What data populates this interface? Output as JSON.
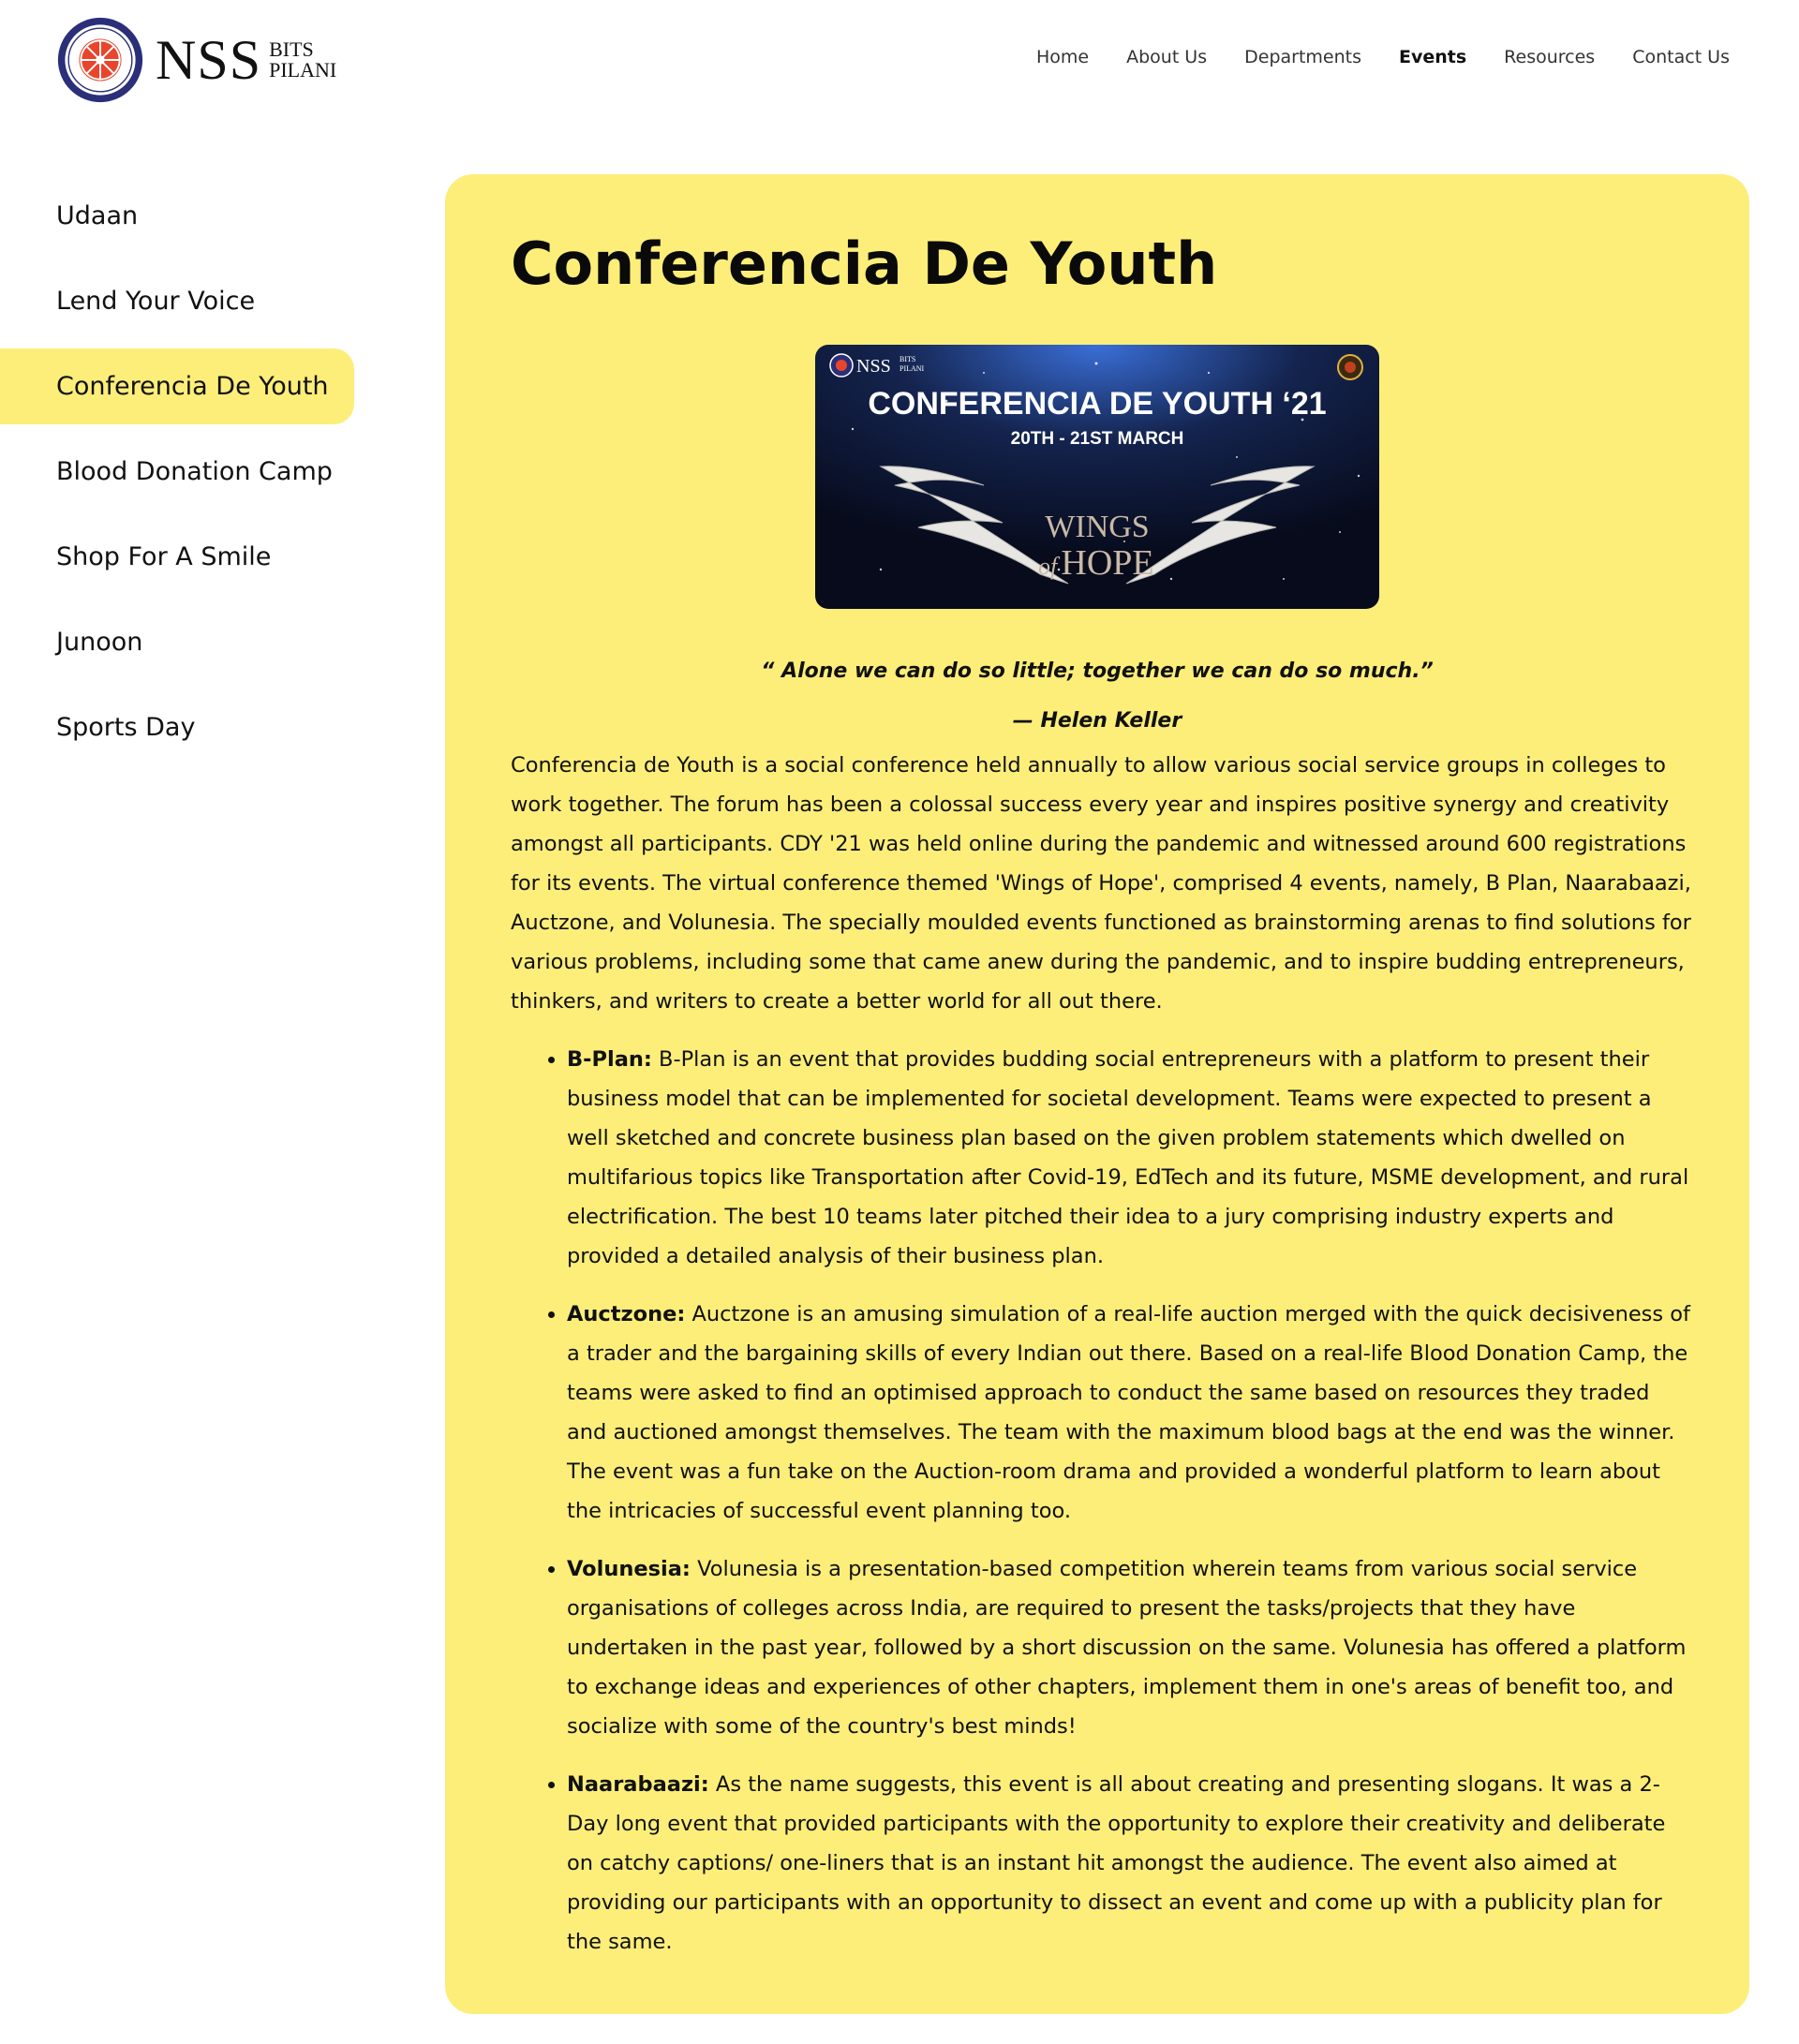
{
  "header": {
    "logo": {
      "name": "NSS",
      "sub_line1": "BITS",
      "sub_line2": "PILANI",
      "emblem_icon": "nss-emblem"
    },
    "nav": [
      {
        "label": "Home",
        "active": false
      },
      {
        "label": "About Us",
        "active": false
      },
      {
        "label": "Departments",
        "active": false
      },
      {
        "label": "Events",
        "active": true
      },
      {
        "label": "Resources",
        "active": false
      },
      {
        "label": "Contact Us",
        "active": false
      }
    ]
  },
  "sidebar": {
    "items": [
      {
        "label": "Udaan",
        "active": false
      },
      {
        "label": "Lend Your Voice",
        "active": false
      },
      {
        "label": "Conferencia De Youth",
        "active": true
      },
      {
        "label": "Blood Donation Camp",
        "active": false
      },
      {
        "label": "Shop For A Smile",
        "active": false
      },
      {
        "label": "Junoon",
        "active": false
      },
      {
        "label": "Sports Day",
        "active": false
      }
    ]
  },
  "main": {
    "title": "Conferencia De Youth",
    "banner": {
      "logo_text": "NSS",
      "logo_sub1": "BITS",
      "logo_sub2": "PILANI",
      "heading": "CONFERENCIA DE YOUTH ‘21",
      "dates": "20TH - 21ST MARCH",
      "theme_line1": "WINGS",
      "theme_of": "of",
      "theme_line2": "HOPE"
    },
    "quote": "“ Alone we can do so little; together we can do so much.”",
    "quote_author": "— Helen Keller",
    "description": "Conferencia de Youth is a social conference held annually to allow various social service groups in colleges to work together. The forum has been a colossal success every year and inspires positive synergy and creativity amongst all participants. CDY '21 was held online during the pandemic and witnessed around 600 registrations for its events. The virtual conference themed 'Wings of Hope', comprised 4 events, namely, B Plan, Naarabaazi, Auctzone, and Volunesia. The specially moulded events functioned as brainstorming arenas to find solutions for various problems, including some that came anew during the pandemic, and to inspire budding entrepreneurs, thinkers, and writers to create a better world for all out there.",
    "events": [
      {
        "name": "B-Plan:",
        "text": "B-Plan is an event that provides budding social entrepreneurs with a platform to present their business model that can be implemented for societal development. Teams were expected to present a well sketched and concrete business plan based on the given problem statements which dwelled on multifarious topics like Transportation after Covid-19, EdTech and its future, MSME development, and rural electrification. The best 10 teams later pitched their idea to a jury comprising industry experts and provided a detailed analysis of their business plan."
      },
      {
        "name": "Auctzone:",
        "text": "Auctzone is an amusing simulation of a real-life auction merged with the quick decisiveness of a trader and the bargaining skills of every Indian out there. Based on a real-life Blood Donation Camp, the teams were asked to find an optimised approach to conduct the same based on resources they traded and auctioned amongst themselves. The team with the maximum blood bags at the end was the winner. The event was a fun take on the Auction-room drama and provided a wonderful platform to learn about the intricacies of successful event planning too."
      },
      {
        "name": "Volunesia:",
        "text": "Volunesia is a presentation-based competition wherein teams from various social service organisations of colleges across India, are required to present the tasks/projects that they have undertaken in the past year, followed by a short discussion on the same. Volunesia has offered a platform to exchange ideas and experiences of other chapters, implement them in one's areas of benefit too, and socialize with some of the country's best minds!"
      },
      {
        "name": "Naarabaazi:",
        "text": "As the name suggests, this event is all about creating and presenting slogans. It was a 2-Day long event that provided participants with the opportunity to explore their creativity and deliberate on catchy captions/ one-liners that is an instant hit amongst the audience. The event also aimed at providing our participants with an opportunity to dissect an event and come up with a publicity plan for the same."
      }
    ]
  },
  "colors": {
    "accent_yellow": "#fcee79",
    "emblem_blue": "#2b2f7a",
    "emblem_red": "#e8452c",
    "banner_dark": "#0b1535"
  }
}
